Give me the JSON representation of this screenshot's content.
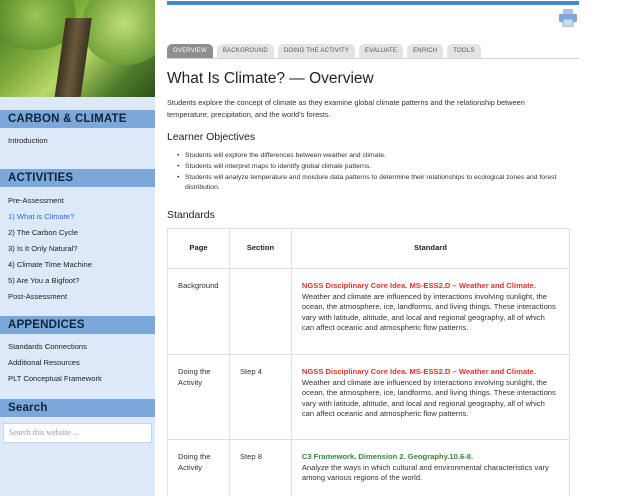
{
  "sidebar": {
    "hero_alt": "tree canopy photo",
    "sections": [
      {
        "title": "CARBON & CLIMATE",
        "items": [
          {
            "label": "Introduction",
            "active": false
          }
        ]
      },
      {
        "title": "ACTIVITIES",
        "items": [
          {
            "label": "Pre-Assessment",
            "active": false
          },
          {
            "label": "1) What is Climate?",
            "active": true
          },
          {
            "label": "2) The Carbon Cycle",
            "active": false
          },
          {
            "label": "3) Is It Only Natural?",
            "active": false
          },
          {
            "label": "4) Climate Time Machine",
            "active": false
          },
          {
            "label": "5) Are You a Bigfoot?",
            "active": false
          },
          {
            "label": "Post-Assessment",
            "active": false
          }
        ]
      },
      {
        "title": "APPENDICES",
        "items": [
          {
            "label": "Standards Connections",
            "active": false
          },
          {
            "label": "Additional Resources",
            "active": false
          },
          {
            "label": "PLT Conceptual Framework",
            "active": false
          }
        ]
      }
    ],
    "search": {
      "title": "Search",
      "placeholder": "Search this website ..."
    }
  },
  "main": {
    "print_icon": "printer-icon",
    "tabs": [
      "OVERVIEW",
      "BACKGROUND",
      "DOING THE ACTIVITY",
      "EVALUATE",
      "ENRICH",
      "TOOLS"
    ],
    "active_tab": 0,
    "title": "What Is Climate? — Overview",
    "intro": "Students explore the concept of climate as they examine global climate patterns and the relationship between temperature, precipitation, and the world's forests.",
    "objectives_heading": "Learner Objectives",
    "objectives": [
      "Students will explore the differences between weather and climate.",
      "Students will interpret maps to identify global climate patterns.",
      "Students will analyze temperature and moisture data patterns to determine their relationships to ecological zones and forest distribution."
    ],
    "standards_heading": "Standards",
    "table": {
      "headers": [
        "Page",
        "Section",
        "Standard"
      ],
      "rows": [
        {
          "page": "Background",
          "section": "",
          "std_title": "NGSS Disciplinary Core Idea. MS-ESS2.D – Weather and Climate.",
          "std_color": "red",
          "std_text": "Weather and climate are influenced by interactions involving sunlight, the ocean, the atmosphere, ice, landforms, and living things. These interactions vary with latitude, altitude, and local and regional geography, all of which can affect oceanic and atmospheric flow patterns."
        },
        {
          "page": "Doing the Activity",
          "section": "Step 4",
          "std_title": "NGSS Disciplinary Core Idea. MS-ESS2.D – Weather and Climate.",
          "std_color": "red",
          "std_text": "Weather and climate are influenced by interactions involving sunlight, the ocean, the atmosphere, ice, landforms, and living things. These interactions vary with latitude, altitude, and local and regional geography, all of which can affect oceanic and atmospheric flow patterns."
        },
        {
          "page": "Doing the Activity",
          "section": "Step 8",
          "std_title": "C3 Framework. Dimension 2. Geography.10.6-8.",
          "std_color": "green",
          "std_text": "Analyze the ways in which cultural and environmental characteristics vary among various regions of the world."
        }
      ]
    }
  }
}
